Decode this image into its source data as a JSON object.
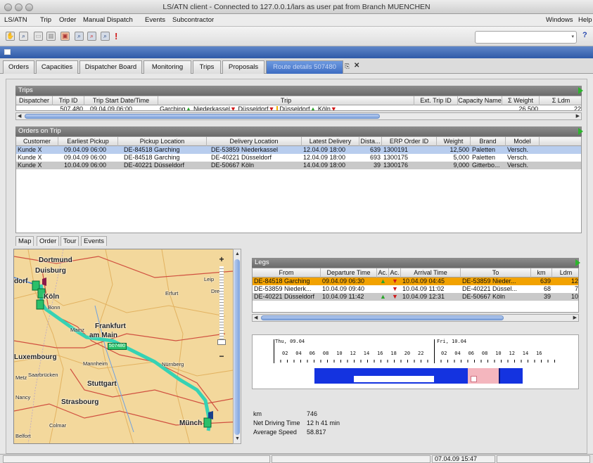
{
  "window": {
    "title": "LS/ATN client - Connected to 127.0.0.1/lars as user pat from Branch MUENCHEN"
  },
  "menu": {
    "items": [
      "LS/ATN",
      "Trip",
      "Order",
      "Manual Dispatch",
      "Events",
      "Subcontractor"
    ],
    "right": [
      "Windows",
      "Help"
    ]
  },
  "toolbar": {
    "icons": [
      "hand-icon",
      "zoom-icon",
      "trip-icon",
      "grid-icon",
      "truck-icon",
      "search-icon",
      "search-red-icon",
      "search-blue-icon",
      "alert-icon"
    ]
  },
  "tabs": {
    "items": [
      "Orders",
      "Capacities",
      "Dispatcher Board",
      "Monitoring",
      "Trips",
      "Proposals",
      "Route details 507480"
    ],
    "active_index": 6
  },
  "trips": {
    "title": "Trips",
    "columns": [
      "Dispatcher",
      "Trip ID",
      "Trip Start Date/Time",
      "Trip",
      "Ext. Trip ID",
      "Capacity Name",
      "Σ Weight",
      "Σ Ldm"
    ],
    "row": {
      "dispatcher": "",
      "trip_id": "507,480",
      "start": "09.04.09 06:00",
      "trip_stops": [
        "Garching",
        "Niederkassel",
        "Düsseldorf",
        "Düsseldorf",
        "Köln"
      ],
      "ext_id": "",
      "capacity": "",
      "weight": "26,500",
      "ldm": "22"
    }
  },
  "orders": {
    "title": "Orders on Trip",
    "columns": [
      "Customer",
      "Earliest Pickup",
      "Pickup Location",
      "Delivery Location",
      "Latest Delivery",
      "Dista...",
      "ERP Order ID",
      "Weight",
      "Brand",
      "Model"
    ],
    "rows": [
      {
        "customer": "Kunde X",
        "pickup": "09.04.09 06:00",
        "pickup_loc": "DE-84518 Garching",
        "delivery_loc": "DE-53859 Niederkassel",
        "latest": "12.04.09 18:00",
        "dist": "639",
        "erp": "1300191",
        "weight": "12,500",
        "brand": "Paletten",
        "model": "Versch."
      },
      {
        "customer": "Kunde X",
        "pickup": "09.04.09 06:00",
        "pickup_loc": "DE-84518 Garching",
        "delivery_loc": "DE-40221 Düsseldorf",
        "latest": "12.04.09 18:00",
        "dist": "693",
        "erp": "1300175",
        "weight": "5,000",
        "brand": "Paletten",
        "model": "Versch."
      },
      {
        "customer": "Kunde X",
        "pickup": "10.04.09 06:00",
        "pickup_loc": "DE-40221 Düsseldorf",
        "delivery_loc": "DE-50667 Köln",
        "latest": "14.04.09 18:00",
        "dist": "39",
        "erp": "1300176",
        "weight": "9,000",
        "brand": "Gitterbo...",
        "model": "Versch."
      }
    ]
  },
  "subtabs": [
    "Map",
    "Order",
    "Tour",
    "Events"
  ],
  "map": {
    "cities": [
      "Dortmund",
      "Duisburg",
      "dorf",
      "Köln",
      "Bonn",
      "Leip",
      "Erfurt",
      "Dres",
      "Mainz",
      "Frankfurt",
      "am Main",
      "Luxembourg",
      "Mannheim",
      "Nürnberg",
      "Metz",
      "Saarbrücken",
      "Stuttgart",
      "Nancy",
      "Strasbourg",
      "Colmar",
      "Belfort",
      "Münch"
    ],
    "trip_label": "507480"
  },
  "legs": {
    "title": "Legs",
    "columns": [
      "From",
      "Departure Time",
      "Ac.",
      "Ac.",
      "Arrival Time",
      "To",
      "km",
      "Ldm"
    ],
    "rows": [
      {
        "from": "DE-84518 Garching",
        "dep": "09.04.09 06:30",
        "arr": "10.04.09 04:45",
        "to": "DE-53859 Nieder...",
        "km": "639",
        "ldm": "12"
      },
      {
        "from": "DE-53859 Niederk...",
        "dep": "10.04.09 09:40",
        "arr": "10.04.09 11:02",
        "to": "DE-40221 Düssel...",
        "km": "68",
        "ldm": "7"
      },
      {
        "from": "DE-40221 Düsseldorf",
        "dep": "10.04.09 11:42",
        "arr": "10.04.09 12:31",
        "to": "DE-50667 Köln",
        "km": "39",
        "ldm": "10"
      }
    ]
  },
  "timeline": {
    "day1": "Thu, 09.04",
    "day2": "Fri, 10.04",
    "hours": [
      "02",
      "04",
      "06",
      "08",
      "10",
      "12",
      "14",
      "16",
      "18",
      "20",
      "22",
      "02",
      "04",
      "06",
      "08",
      "10",
      "12",
      "14",
      "16"
    ]
  },
  "stats": {
    "km_label": "km",
    "km_value": "746",
    "drive_label": "Net Driving Time",
    "drive_value": "12 h 41 min",
    "speed_label": "Average Speed",
    "speed_value": "58.817"
  },
  "status": {
    "datetime": "07.04.09 15:47"
  },
  "colors": {
    "selected_row": "#b8cdee",
    "leg_selected": "#f2a200",
    "route": "#36d2b4",
    "timeline_blue": "#1433e0",
    "timeline_pink": "#f4b6be"
  }
}
